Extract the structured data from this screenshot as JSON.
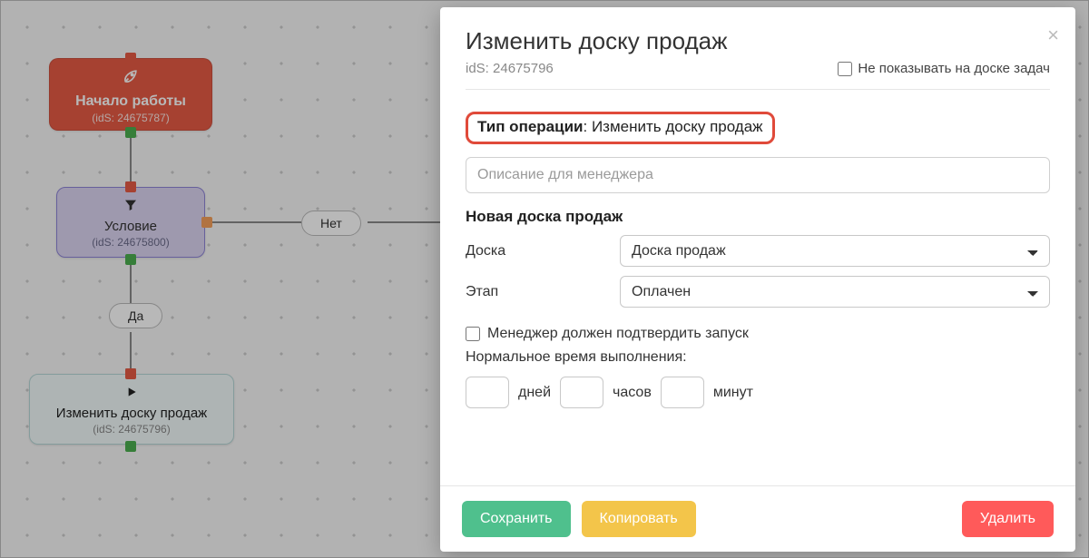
{
  "flow": {
    "start": {
      "title": "Начало работы",
      "sub": "(idS: 24675787)"
    },
    "condition": {
      "title": "Условие",
      "sub": "(idS: 24675800)"
    },
    "change": {
      "title": "Изменить доску продаж",
      "sub": "(idS: 24675796)"
    },
    "no_label": "Нет",
    "yes_label": "Да"
  },
  "modal": {
    "title": "Изменить доску продаж",
    "sub": "idS: 24675796",
    "hide_on_board_label": "Не показывать на доске задач",
    "op_type_label": "Тип операции",
    "op_type_value": "Изменить доску продаж",
    "desc_placeholder": "Описание для менеджера",
    "section_label": "Новая доска продаж",
    "board_label": "Доска",
    "board_value": "Доска продаж",
    "stage_label": "Этап",
    "stage_value": "Оплачен",
    "confirm_label": "Менеджер должен подтвердить запуск",
    "normal_time_label": "Нормальное время выполнения:",
    "days_label": "дней",
    "hours_label": "часов",
    "minutes_label": "минут",
    "save_label": "Сохранить",
    "copy_label": "Копировать",
    "delete_label": "Удалить"
  }
}
